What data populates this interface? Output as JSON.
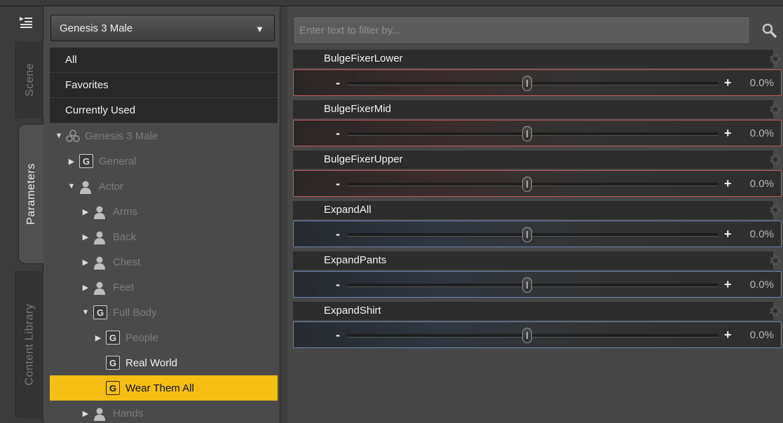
{
  "rail": {
    "tabs": [
      {
        "label": "Scene"
      },
      {
        "label": "Parameters"
      },
      {
        "label": "Content Library"
      }
    ]
  },
  "category_pane": {
    "selected_figure": "Genesis 3 Male",
    "quick_items": [
      "All",
      "Favorites",
      "Currently Used"
    ],
    "tree": [
      {
        "label": "Genesis 3 Male",
        "icon": "figure-icon",
        "expanded": true
      },
      {
        "label": "General",
        "icon": "group-icon",
        "expanded": false
      },
      {
        "label": "Actor",
        "icon": "person-icon",
        "expanded": true
      },
      {
        "label": "Arms",
        "icon": "person-icon",
        "expanded": false
      },
      {
        "label": "Back",
        "icon": "person-icon",
        "expanded": false
      },
      {
        "label": "Chest",
        "icon": "person-icon",
        "expanded": false
      },
      {
        "label": "Feet",
        "icon": "person-icon",
        "expanded": false
      },
      {
        "label": "Full Body",
        "icon": "group-icon",
        "expanded": true
      },
      {
        "label": "People",
        "icon": "group-icon",
        "expanded": false
      },
      {
        "label": "Real World",
        "icon": "group-icon"
      },
      {
        "label": "Wear Them All",
        "icon": "group-icon",
        "selected": true
      },
      {
        "label": "Hands",
        "icon": "person-icon",
        "expanded": false
      }
    ]
  },
  "params_pane": {
    "filter_placeholder": "Enter text to filter by...",
    "parameters": [
      {
        "name": "BulgeFixerLower",
        "minus": "-",
        "plus": "+",
        "value": "0.0%",
        "accent": "red"
      },
      {
        "name": "BulgeFixerMid",
        "minus": "-",
        "plus": "+",
        "value": "0.0%",
        "accent": "red"
      },
      {
        "name": "BulgeFixerUpper",
        "minus": "-",
        "plus": "+",
        "value": "0.0%",
        "accent": "red"
      },
      {
        "name": "ExpandAll",
        "minus": "-",
        "plus": "+",
        "value": "0.0%",
        "accent": "blue"
      },
      {
        "name": "ExpandPants",
        "minus": "-",
        "plus": "+",
        "value": "0.0%",
        "accent": "blue"
      },
      {
        "name": "ExpandShirt",
        "minus": "-",
        "plus": "+",
        "value": "0.0%",
        "accent": "blue"
      }
    ]
  },
  "colors": {
    "selection": "#f5be12",
    "red_accent": "#c45a5a",
    "blue_accent": "#6c86b3"
  }
}
